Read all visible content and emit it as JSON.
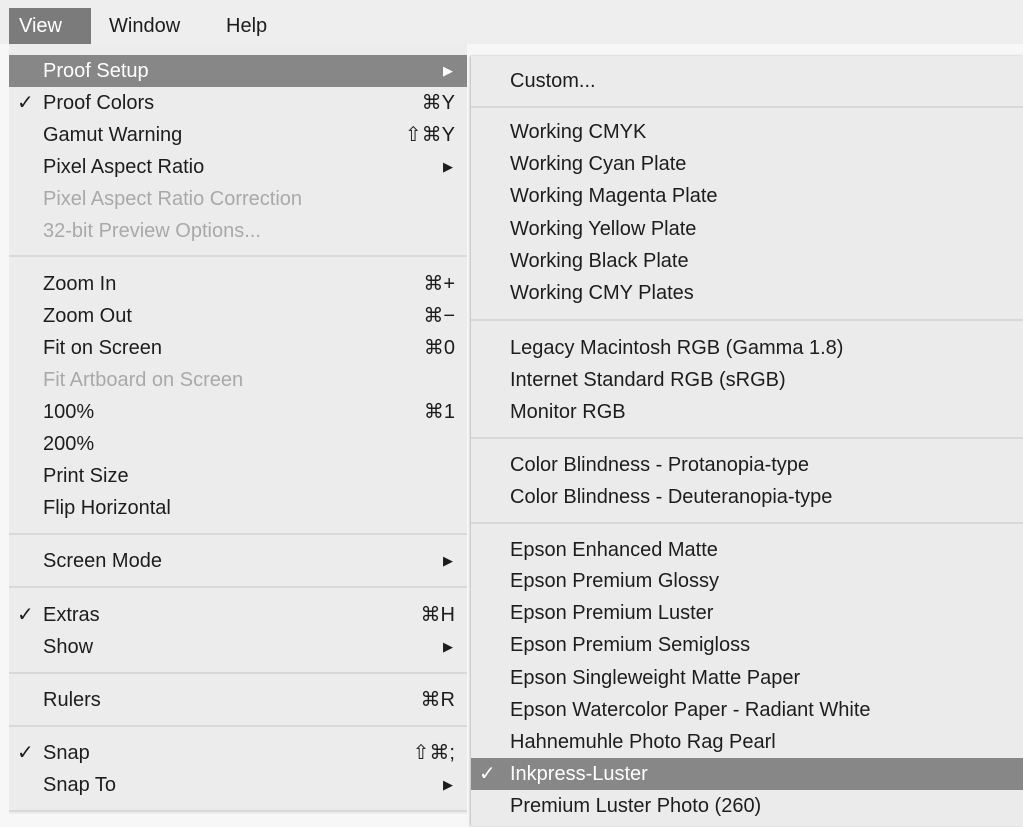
{
  "menubar": {
    "view": "View",
    "window": "Window",
    "help": "Help"
  },
  "main": {
    "proof_setup": "Proof Setup",
    "proof_colors": "Proof Colors",
    "proof_colors_sc": "⌘Y",
    "gamut_warning": "Gamut Warning",
    "gamut_warning_sc": "⇧⌘Y",
    "pixel_aspect_ratio": "Pixel Aspect Ratio",
    "pixel_aspect_ratio_correction": "Pixel Aspect Ratio Correction",
    "preview_options": "32-bit Preview Options...",
    "zoom_in": "Zoom In",
    "zoom_in_sc": "⌘+",
    "zoom_out": "Zoom Out",
    "zoom_out_sc": "⌘−",
    "fit_on_screen": "Fit on Screen",
    "fit_on_screen_sc": "⌘0",
    "fit_artboard": "Fit Artboard on Screen",
    "zoom_100": "100%",
    "zoom_100_sc": "⌘1",
    "zoom_200": "200%",
    "print_size": "Print Size",
    "flip_horizontal": "Flip Horizontal",
    "screen_mode": "Screen Mode",
    "extras": "Extras",
    "extras_sc": "⌘H",
    "show": "Show",
    "rulers": "Rulers",
    "rulers_sc": "⌘R",
    "snap": "Snap",
    "snap_sc": "⇧⌘;",
    "snap_to": "Snap To"
  },
  "sub": {
    "custom": "Custom...",
    "working_cmyk": "Working CMYK",
    "working_cyan": "Working Cyan Plate",
    "working_magenta": "Working Magenta Plate",
    "working_yellow": "Working Yellow Plate",
    "working_black": "Working Black Plate",
    "working_cmy": "Working CMY Plates",
    "legacy_mac": "Legacy Macintosh RGB (Gamma 1.8)",
    "internet_srgb": "Internet Standard RGB (sRGB)",
    "monitor_rgb": "Monitor RGB",
    "protanopia": "Color Blindness - Protanopia-type",
    "deuteranopia": "Color Blindness - Deuteranopia-type",
    "epson_enhanced_matte": "Epson Enhanced Matte",
    "epson_premium_glossy": "Epson Premium Glossy",
    "epson_premium_luster": "Epson Premium Luster",
    "epson_premium_semigloss": "Epson Premium Semigloss",
    "epson_singleweight": "Epson Singleweight Matte Paper",
    "epson_watercolor": "Epson Watercolor Paper - Radiant White",
    "hahnemuhle": "Hahnemuhle Photo Rag Pearl",
    "inkpress": "Inkpress-Luster",
    "premium_luster": "Premium Luster Photo  (260)"
  },
  "glyphs": {
    "check": "✓",
    "arrow": "▶"
  }
}
